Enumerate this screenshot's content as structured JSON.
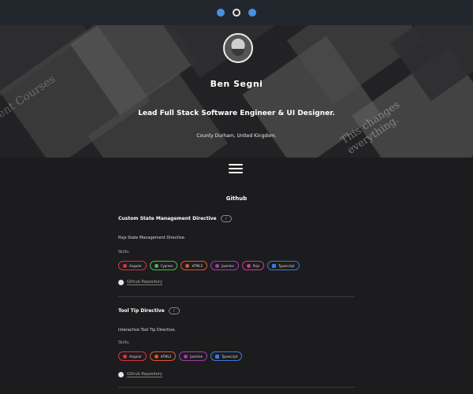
{
  "topbar": {
    "icons": [
      "linkedin-icon",
      "github-icon",
      "email-icon"
    ]
  },
  "hero": {
    "name": "Ben Segni",
    "role": "Lead Full Stack Software Engineer & UI Designer.",
    "location": "County Durham, United Kingdom.",
    "bg_text_left": "ent Courses",
    "bg_text_right_1": "This changes",
    "bg_text_right_2": "everything."
  },
  "section": {
    "title": "Github"
  },
  "projects": [
    {
      "title": "Custom State Management Directive",
      "info": "i",
      "description": "Rxjs State Management Directive.",
      "skills_label": "Skills:",
      "tags": [
        "Angular",
        "Cypress",
        "HTML5",
        "Jasmine",
        "Rxjs",
        "Typescript"
      ],
      "repo_label": "Github Repository"
    },
    {
      "title": "Tool Tip Directive",
      "info": "i",
      "description": "Interactive Tool Tip Directive.",
      "skills_label": "Skills:",
      "tags": [
        "Angular",
        "HTML5",
        "Jasmine",
        "Typescript"
      ],
      "repo_label": "Github Repository"
    }
  ],
  "colors": {
    "background": "#1c1c1e",
    "topbar": "#22262d",
    "angular": "#d9323e",
    "cypress": "#4fb84f",
    "html5": "#e0542e",
    "jasmine": "#a63ab0",
    "rxjs": "#d23690",
    "typescript": "#3a78d8"
  }
}
